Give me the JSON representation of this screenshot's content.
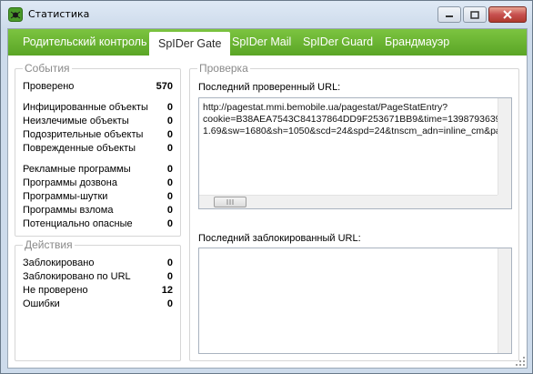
{
  "window": {
    "title": "Статистика",
    "controls": {
      "minimize": "minimize-icon",
      "maximize": "maximize-icon",
      "close": "close-icon"
    }
  },
  "tabs": [
    {
      "label": "Родительский контроль",
      "active": false
    },
    {
      "label": "SpIDer Gate",
      "active": true
    },
    {
      "label": "SpIDer Mail",
      "active": false
    },
    {
      "label": "SpIDer Guard",
      "active": false
    },
    {
      "label": "Брандмауэр",
      "active": false
    }
  ],
  "events": {
    "title": "События",
    "checked": {
      "label": "Проверено",
      "value": "570"
    },
    "infected": {
      "label": "Инфицированные объекты",
      "value": "0"
    },
    "incurable": {
      "label": "Неизлечимые объекты",
      "value": "0"
    },
    "suspicious": {
      "label": "Подозрительные объекты",
      "value": "0"
    },
    "damaged": {
      "label": "Поврежденные объекты",
      "value": "0"
    },
    "adware": {
      "label": "Рекламные программы",
      "value": "0"
    },
    "dialers": {
      "label": "Программы дозвона",
      "value": "0"
    },
    "jokes": {
      "label": "Программы-шутки",
      "value": "0"
    },
    "hacktools": {
      "label": "Программы взлома",
      "value": "0"
    },
    "riskware": {
      "label": "Потенциально опасные",
      "value": "0"
    }
  },
  "actions": {
    "title": "Действия",
    "blocked": {
      "label": "Заблокировано",
      "value": "0"
    },
    "blocked_url": {
      "label": "Заблокировано по URL",
      "value": "0"
    },
    "not_checked": {
      "label": "Не проверено",
      "value": "12"
    },
    "errors": {
      "label": "Ошибки",
      "value": "0"
    }
  },
  "check": {
    "title": "Проверка",
    "last_checked_label": "Последний проверенный URL:",
    "last_checked_url": "http://pagestat.mmi.bemobile.ua/pagestat/PageStatEntry?\ncookie=B38AEA7543C84137864DD9F253671BB9&time=13987936398\n1.69&sw=1680&sh=1050&scd=24&spd=24&tnscm_adn=inline_cm&pa",
    "last_blocked_label": "Последний заблокированный URL:",
    "last_blocked_url": ""
  },
  "colors": {
    "tabbar": "#6bb632",
    "tab_text": "#ffffff",
    "group_title": "#8a8a8a"
  }
}
